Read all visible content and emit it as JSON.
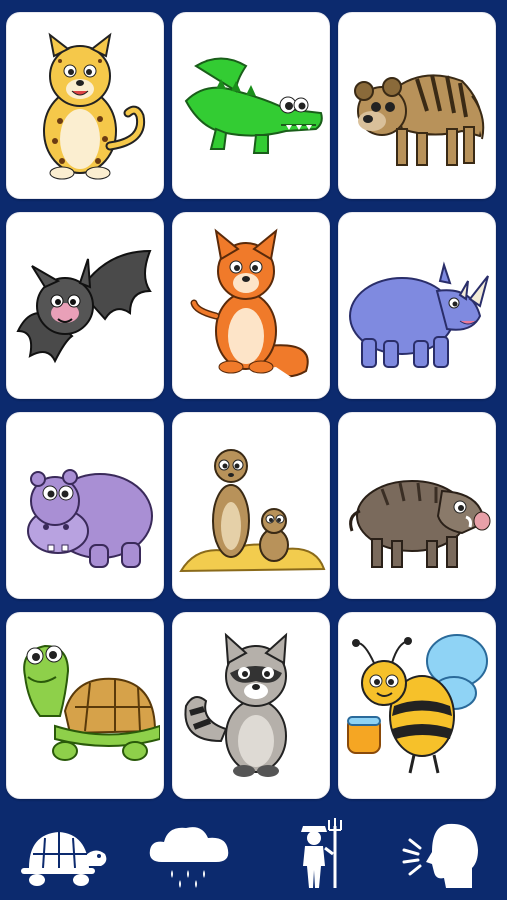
{
  "grid": {
    "cards": [
      {
        "name": "cheetah-card",
        "icon": "cheetah-icon"
      },
      {
        "name": "crocodile-card",
        "icon": "crocodile-icon"
      },
      {
        "name": "hyena-card",
        "icon": "hyena-icon"
      },
      {
        "name": "bat-card",
        "icon": "bat-icon"
      },
      {
        "name": "fox-card",
        "icon": "fox-icon"
      },
      {
        "name": "rhino-card",
        "icon": "rhino-icon"
      },
      {
        "name": "hippo-card",
        "icon": "hippo-icon"
      },
      {
        "name": "meerkat-card",
        "icon": "meerkat-icon"
      },
      {
        "name": "boar-card",
        "icon": "boar-icon"
      },
      {
        "name": "turtle-card",
        "icon": "turtle-icon"
      },
      {
        "name": "raccoon-card",
        "icon": "raccoon-icon"
      },
      {
        "name": "bee-card",
        "icon": "bee-icon"
      }
    ]
  },
  "bottom_nav": {
    "items": [
      {
        "name": "animals-category-button",
        "icon": "turtle-silhouette-icon"
      },
      {
        "name": "weather-category-button",
        "icon": "rain-cloud-icon"
      },
      {
        "name": "farm-category-button",
        "icon": "farmer-with-pitchfork-icon"
      },
      {
        "name": "speak-button",
        "icon": "speaking-head-icon"
      }
    ]
  },
  "colors": {
    "background": "#0c2a6e",
    "card": "#ffffff",
    "nav_icon": "#ffffff"
  }
}
